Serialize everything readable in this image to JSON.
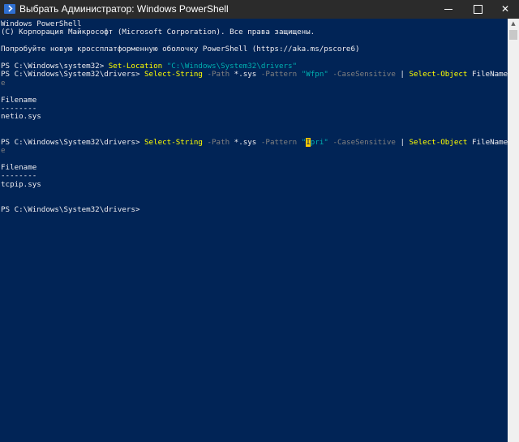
{
  "window": {
    "title": "Выбрать Администратор: Windows PowerShell",
    "minimize_glyph": "—",
    "maximize_glyph": "☐",
    "close_glyph": "✕"
  },
  "console": {
    "lines": [
      [
        {
          "t": "Windows PowerShell",
          "c": "plain"
        }
      ],
      [
        {
          "t": "(C) Корпорация Майкрософт (Microsoft Corporation). Все права защищены.",
          "c": "plain"
        }
      ],
      [],
      [
        {
          "t": "Попробуйте новую кроссплатформенную оболочку PowerShell (https://aka.ms/pscore6)",
          "c": "plain"
        }
      ],
      [],
      [
        {
          "t": "PS C:\\Windows\\system32> ",
          "c": "plain"
        },
        {
          "t": "Set-Location",
          "c": "cmd"
        },
        {
          "t": " ",
          "c": "plain"
        },
        {
          "t": "\"C:\\Windows\\System32\\drivers\"",
          "c": "str"
        }
      ],
      [
        {
          "t": "PS C:\\Windows\\System32\\drivers> ",
          "c": "plain"
        },
        {
          "t": "Select-String",
          "c": "cmd"
        },
        {
          "t": " -Path",
          "c": "param"
        },
        {
          "t": " *.sys",
          "c": "plain"
        },
        {
          "t": " -Pattern",
          "c": "param"
        },
        {
          "t": " ",
          "c": "plain"
        },
        {
          "t": "\"Wfpn\"",
          "c": "str"
        },
        {
          "t": " -CaseSensitive",
          "c": "param"
        },
        {
          "t": " | ",
          "c": "plain"
        },
        {
          "t": "Select-Object",
          "c": "cmd"
        },
        {
          "t": " FileName",
          "c": "plain"
        },
        {
          "t": " -Uniqu",
          "c": "param"
        }
      ],
      [
        {
          "t": "e",
          "c": "param"
        }
      ],
      [],
      [
        {
          "t": "Filename",
          "c": "plain"
        }
      ],
      [
        {
          "t": "--------",
          "c": "plain"
        }
      ],
      [
        {
          "t": "netio.sys",
          "c": "plain"
        }
      ],
      [],
      [],
      [
        {
          "t": "PS C:\\Windows\\System32\\drivers> ",
          "c": "plain"
        },
        {
          "t": "Select-String",
          "c": "cmd"
        },
        {
          "t": " -Path",
          "c": "param"
        },
        {
          "t": " *.sys",
          "c": "plain"
        },
        {
          "t": " -Pattern",
          "c": "param"
        },
        {
          "t": " ",
          "c": "plain"
        },
        {
          "t": "\"",
          "c": "str"
        },
        {
          "t": "I",
          "c": "cursor"
        },
        {
          "t": "pri\"",
          "c": "str"
        },
        {
          "t": " -CaseSensitive",
          "c": "param"
        },
        {
          "t": " | ",
          "c": "plain"
        },
        {
          "t": "Select-Object",
          "c": "cmd"
        },
        {
          "t": " FileName",
          "c": "plain"
        },
        {
          "t": " -Uniqu",
          "c": "param"
        }
      ],
      [
        {
          "t": "e",
          "c": "param"
        }
      ],
      [],
      [
        {
          "t": "Filename",
          "c": "plain"
        }
      ],
      [
        {
          "t": "--------",
          "c": "plain"
        }
      ],
      [
        {
          "t": "tcpip.sys",
          "c": "plain"
        }
      ],
      [],
      [],
      [
        {
          "t": "PS C:\\Windows\\System32\\drivers>",
          "c": "plain"
        }
      ]
    ]
  },
  "scrollbar": {
    "up_glyph": "▲"
  }
}
